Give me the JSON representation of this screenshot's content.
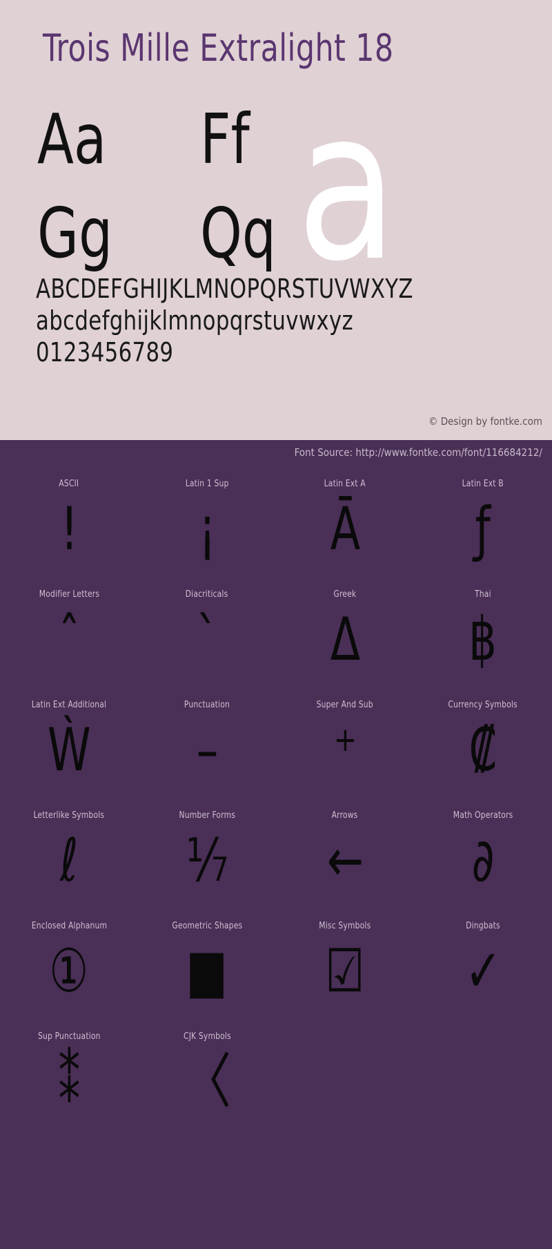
{
  "specimen": {
    "title": "Trois Mille Extralight 18",
    "letter_pairs": [
      "Aa",
      "Ff",
      "Gg",
      "Qq"
    ],
    "giant_glyph": "a",
    "alphabet_uppercase": "ABCDEFGHIJKLMNOPQRSTUVWXYZ",
    "alphabet_lowercase": "abcdefghijklmnopqrstuvwxyz",
    "digits": "0123456789",
    "credit": "© Design by fontke.com"
  },
  "blocks_panel": {
    "font_source": "Font Source: http://www.fontke.com/font/116684212/",
    "blocks": [
      {
        "label": "ASCII",
        "glyph": "!"
      },
      {
        "label": "Latin 1 Sup",
        "glyph": "¡"
      },
      {
        "label": "Latin Ext A",
        "glyph": "Ā"
      },
      {
        "label": "Latin Ext B",
        "glyph": "ƒ"
      },
      {
        "label": "Modifier Letters",
        "glyph": "ˆ"
      },
      {
        "label": "Diacriticals",
        "glyph": "`"
      },
      {
        "label": "Greek",
        "glyph": "Δ"
      },
      {
        "label": "Thai",
        "glyph": "฿"
      },
      {
        "label": "Latin Ext Additional",
        "glyph": "Ẁ"
      },
      {
        "label": "Punctuation",
        "glyph": "–"
      },
      {
        "label": "Super And Sub",
        "glyph": "⁺"
      },
      {
        "label": "Currency Symbols",
        "glyph": "₡"
      },
      {
        "label": "Letterlike Symbols",
        "glyph": "ℓ"
      },
      {
        "label": "Number Forms",
        "glyph": "⅐"
      },
      {
        "label": "Arrows",
        "glyph": "←"
      },
      {
        "label": "Math Operators",
        "glyph": "∂"
      },
      {
        "label": "Enclosed Alphanum",
        "glyph": "①"
      },
      {
        "label": "Geometric Shapes",
        "glyph": "■"
      },
      {
        "label": "Misc Symbols",
        "glyph": "☑"
      },
      {
        "label": "Dingbats",
        "glyph": "✓"
      },
      {
        "label": "Sup Punctuation",
        "glyph": "⁑"
      },
      {
        "label": "CJK Symbols",
        "glyph": "〈"
      }
    ]
  },
  "colors": {
    "specimen_background": "#e0d1d4",
    "panel_background": "#4a2f57",
    "title": "#5a3670",
    "glyph": "#111111",
    "giant_glyph": "#ffffff",
    "label": "#cdbfd0",
    "credit": "#5d5055"
  }
}
